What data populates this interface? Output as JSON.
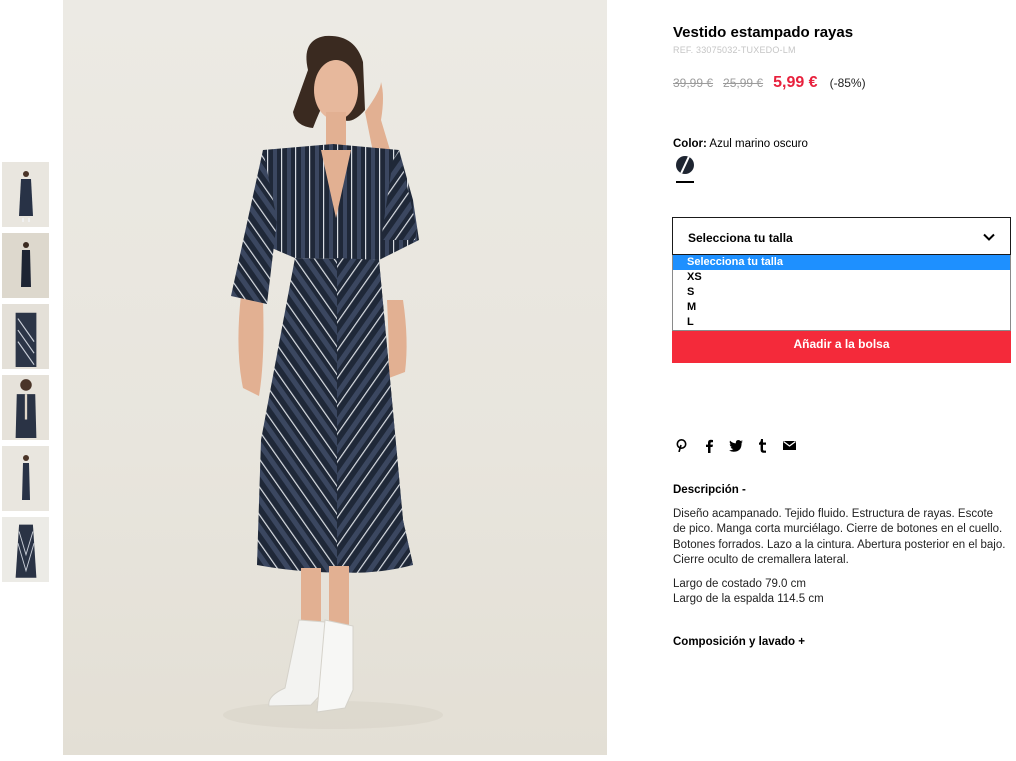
{
  "product": {
    "title": "Vestido estampado rayas",
    "ref": "REF. 33075032-TUXEDO-LM",
    "old_price_1": "39,99 €",
    "old_price_2": "25,99 €",
    "price": "5,99 €",
    "discount": "(-85%)"
  },
  "color": {
    "label": "Color:",
    "value": "Azul marino oscuro",
    "swatch_hex": "#1e2531"
  },
  "size": {
    "placeholder": "Selecciona tu talla",
    "options": [
      "Selecciona tu talla",
      "XS",
      "S",
      "M",
      "L"
    ],
    "selected_index": 0
  },
  "cart": {
    "add_label": "Añadir a la bolsa",
    "accent": "#f42a3a"
  },
  "share_icons": [
    "pinterest-icon",
    "facebook-icon",
    "twitter-icon",
    "tumblr-icon",
    "email-icon"
  ],
  "description": {
    "heading": "Descripción -",
    "text": "Diseño acampanado. Tejido fluido. Estructura de rayas. Escote de pico. Manga corta murciélago. Cierre de botones en el cuello. Botones forrados. Lazo a la cintura. Abertura posterior en el bajo. Cierre oculto de cremallera lateral.",
    "measure_1": "Largo de costado 79.0 cm",
    "measure_2": "Largo de la espalda 114.5 cm"
  },
  "composition": {
    "heading": "Composición y lavado +"
  },
  "thumbnails_count": 6,
  "colors": {
    "price_red": "#e8213d",
    "selected_option": "#1e90ff",
    "navy": "#1e2531"
  }
}
